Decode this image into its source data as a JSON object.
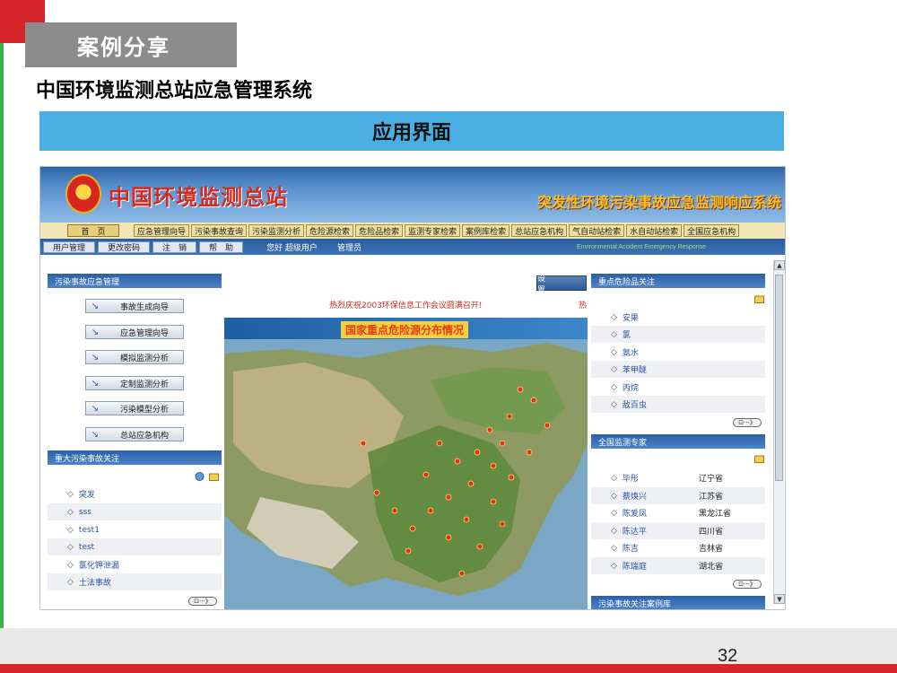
{
  "slide": {
    "section_tag": "案例分享",
    "title": "中国环境监测总站应急管理系统",
    "bar_title": "应用界面",
    "page_number": "32"
  },
  "app": {
    "org_name": "中国环境监测总站",
    "system_name": "突发性环境污染事故应急监测响应系统",
    "nav": {
      "home": "首　页",
      "items": [
        "应急管理向导",
        "污染事故查询",
        "污染监测分析",
        "危险源检索",
        "危险品检索",
        "监测专家检索",
        "案例库检索",
        "总站应急机构",
        "气自动站检索",
        "水自动站检索",
        "全国应急机构"
      ]
    },
    "user_tabs": [
      "用户管理",
      "更改密码",
      "注　销",
      "帮　助"
    ],
    "user_greeting": "您好 超级用户",
    "user_role": "管理员",
    "eng_title": "Environmental Accident Emergency Response",
    "left_panel": {
      "title": "污染事故应急管理",
      "buttons": [
        "事故生成向导",
        "应急管理向导",
        "模拟监测分析",
        "定制监测分析",
        "污染模型分析",
        "总站应急机构"
      ]
    },
    "accident_panel": {
      "title": "重大污染事故关注",
      "items": [
        "突发",
        "sss",
        "test1",
        "test",
        "氯化钾泄漏",
        "土法事故"
      ]
    },
    "center": {
      "settings_label": "设　置",
      "ticker": "热烈庆祝2003环保信息工作会议圆满召开!",
      "ticker_tail": "热",
      "map_title": "国家重点危险源分布情况"
    },
    "hazard_panel": {
      "title": "重点危险品关注",
      "items": [
        "安果",
        "氯",
        "氨水",
        "苯甲醚",
        "丙烷",
        "敌百虫"
      ]
    },
    "expert_panel": {
      "title": "全国监测专家",
      "items": [
        {
          "name": "毕彤",
          "province": "辽宁省"
        },
        {
          "name": "蔡焕兴",
          "province": "江苏省"
        },
        {
          "name": "陈爱凤",
          "province": "黑龙江省"
        },
        {
          "name": "陈达平",
          "province": "四川省"
        },
        {
          "name": "陈吉",
          "province": "吉林省"
        },
        {
          "name": "陈瑞庭",
          "province": "湖北省"
        }
      ]
    },
    "more_label": "⊡···》",
    "next_panel_partial": "污染事故关注案例库"
  },
  "colors": {
    "slide_red": "#d7262b",
    "slide_green": "#3cb44a",
    "bar_blue": "#4aaee3",
    "panel_blue": "#2c60a5",
    "link_blue": "#2a55a3"
  }
}
